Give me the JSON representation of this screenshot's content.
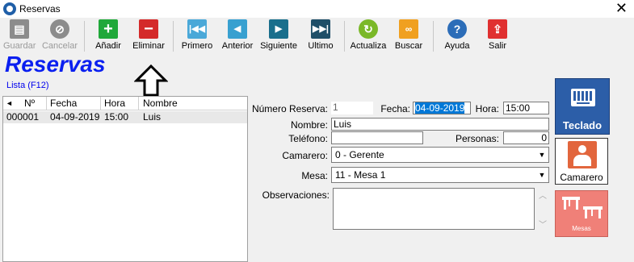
{
  "window": {
    "title": "Reservas",
    "close_glyph": "✕"
  },
  "toolbar": {
    "buttons": [
      {
        "label": "Guardar",
        "icon": "save-icon",
        "color": "#8c8c8c",
        "enabled": false
      },
      {
        "label": "Cancelar",
        "icon": "cancel-icon",
        "color": "#8c8c8c",
        "enabled": false
      },
      {
        "label": "Añadir",
        "icon": "plus-icon",
        "color": "#20a83a",
        "enabled": true
      },
      {
        "label": "Eliminar",
        "icon": "minus-icon",
        "color": "#d42a2a",
        "enabled": true
      },
      {
        "label": "Primero",
        "icon": "first-icon",
        "color": "#4aa8d8",
        "enabled": true
      },
      {
        "label": "Anterior",
        "icon": "prev-icon",
        "color": "#38a0d0",
        "enabled": true
      },
      {
        "label": "Siguiente",
        "icon": "next-icon",
        "color": "#1a6f8c",
        "enabled": true
      },
      {
        "label": "Ultimo",
        "icon": "last-icon",
        "color": "#1f4f68",
        "enabled": true
      },
      {
        "label": "Actualiza",
        "icon": "refresh-icon",
        "color": "#7ab828",
        "enabled": true
      },
      {
        "label": "Buscar",
        "icon": "binoculars-icon",
        "color": "#f0a020",
        "enabled": true
      },
      {
        "label": "Ayuda",
        "icon": "help-icon",
        "color": "#2c6db8",
        "enabled": true
      },
      {
        "label": "Salir",
        "icon": "exit-icon",
        "color": "#e03030",
        "enabled": true
      }
    ]
  },
  "heading": "Reservas",
  "list_link": "Lista (F12)",
  "list": {
    "columns": [
      "Nº",
      "Fecha",
      "Hora",
      "Nombre"
    ],
    "rows": [
      {
        "numero": "000001",
        "fecha": "04-09-2019",
        "hora": "15:00",
        "nombre": "Luis"
      }
    ]
  },
  "form": {
    "numero_label": "Número Reserva:",
    "numero_value": "1",
    "fecha_label": "Fecha:",
    "fecha_value": "04-09-2019",
    "hora_label": "Hora:",
    "hora_value": "15:00",
    "nombre_label": "Nombre:",
    "nombre_value": "Luis",
    "telefono_label": "Teléfono:",
    "telefono_value": "",
    "personas_label": "Personas:",
    "personas_value": "0",
    "camarero_label": "Camarero:",
    "camarero_value": "0 - Gerente",
    "mesa_label": "Mesa:",
    "mesa_value": "11 - Mesa 1",
    "observaciones_label": "Observaciones:",
    "observaciones_value": ""
  },
  "side": {
    "teclado": "Teclado",
    "camarero": "Camarero",
    "mesas": "Mesas"
  },
  "colors": {
    "heading": "#0a1ff0",
    "selection": "#0078d7",
    "teclado_bg": "#2c5ea8",
    "camarero_icon": "#e2663d",
    "mesas_bg": "#f08078"
  }
}
